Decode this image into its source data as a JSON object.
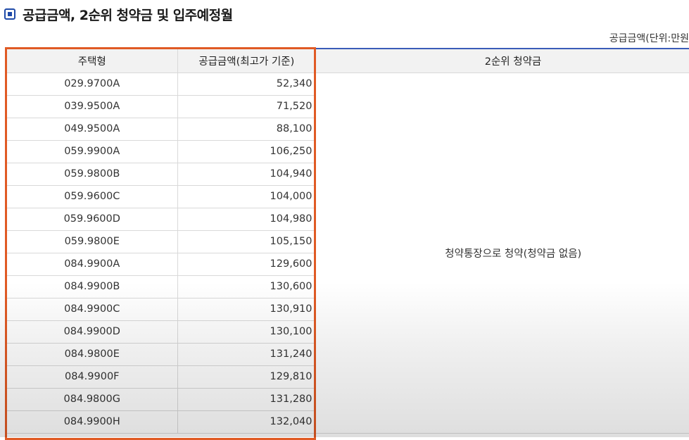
{
  "section": {
    "title": "공급금액, 2순위 청약금 및 입주예정월",
    "icon": "square-bullet-icon",
    "accent_color": "#1f4aa8"
  },
  "unit_note": "공급금액(단위:만원",
  "table": {
    "headers": {
      "type": "주택형",
      "price": "공급금액(최고가 기준)",
      "deposit": "2순위 청약금"
    },
    "deposit_note": "청약통장으로 청약(청약금 없음)",
    "highlight_color": "#e05a24",
    "rows": [
      {
        "type": "029.9700A",
        "price": "52,340"
      },
      {
        "type": "039.9500A",
        "price": "71,520"
      },
      {
        "type": "049.9500A",
        "price": "88,100"
      },
      {
        "type": "059.9900A",
        "price": "106,250"
      },
      {
        "type": "059.9800B",
        "price": "104,940"
      },
      {
        "type": "059.9600C",
        "price": "104,000"
      },
      {
        "type": "059.9600D",
        "price": "104,980"
      },
      {
        "type": "059.9800E",
        "price": "105,150"
      },
      {
        "type": "084.9900A",
        "price": "129,600"
      },
      {
        "type": "084.9900B",
        "price": "130,600"
      },
      {
        "type": "084.9900C",
        "price": "130,910"
      },
      {
        "type": "084.9900D",
        "price": "130,100"
      },
      {
        "type": "084.9800E",
        "price": "131,240"
      },
      {
        "type": "084.9900F",
        "price": "129,810"
      },
      {
        "type": "084.9800G",
        "price": "131,280"
      },
      {
        "type": "084.9900H",
        "price": "132,040"
      }
    ]
  }
}
